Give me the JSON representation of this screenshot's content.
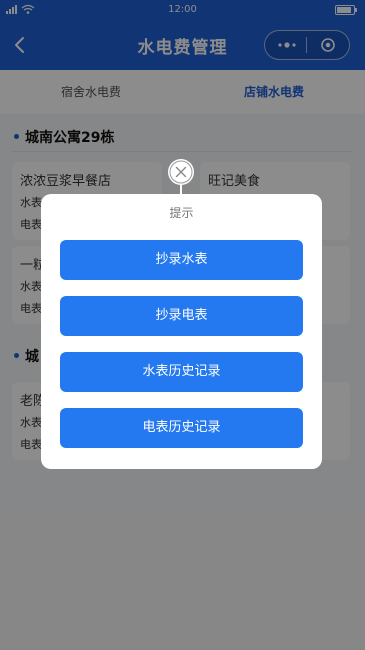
{
  "status": {
    "time": "12:00"
  },
  "nav": {
    "title": "水电费管理"
  },
  "tabs": [
    {
      "label": "宿舍水电费",
      "active": false
    },
    {
      "label": "店铺水电费",
      "active": true
    }
  ],
  "sections": [
    {
      "title": "城南公寓29栋",
      "cards": [
        {
          "name": "浓浓豆浆早餐店",
          "water": "水表",
          "electric": "电表"
        },
        {
          "name": "旺记美食"
        },
        {
          "name": "一粒",
          "water": "水表",
          "electric": "电表"
        }
      ]
    },
    {
      "title": "城",
      "cards": [
        {
          "name": "老陈",
          "water": "水表",
          "electric": "电表"
        }
      ]
    }
  ],
  "modal": {
    "hint": "提示",
    "buttons": [
      "抄录水表",
      "抄录电表",
      "水表历史记录",
      "电表历史记录"
    ]
  },
  "colors": {
    "primary": "#1f5fd3",
    "button": "#2479f0"
  },
  "icons": {
    "back": "chevron-left-icon",
    "more": "more-dots-icon",
    "capsule_close": "target-icon",
    "modal_close": "close-icon"
  }
}
